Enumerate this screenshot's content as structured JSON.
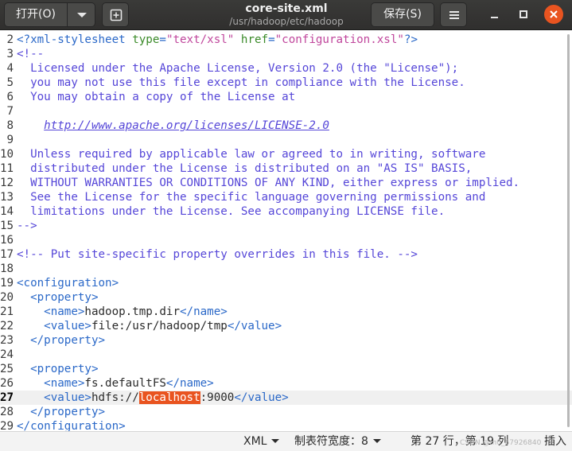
{
  "header": {
    "open_label": "打开(O)",
    "title": "core-site.xml",
    "path": "/usr/hadoop/etc/hadoop",
    "save_label": "保存(S)",
    "icons": {
      "open_menu": "triangle-down-icon",
      "new_tab": "new-document-icon",
      "menu": "hamburger-icon",
      "minimize": "minimize-icon",
      "maximize": "maximize-icon",
      "close": "close-icon"
    },
    "close_color": "#e95420"
  },
  "editor": {
    "current_line": "27",
    "lines": [
      {
        "n": "2",
        "segs": [
          {
            "t": "<?xml-stylesheet ",
            "c": "tag"
          },
          {
            "t": "type",
            "c": "attr"
          },
          {
            "t": "=",
            "c": "tag"
          },
          {
            "t": "\"text/xsl\"",
            "c": "str"
          },
          {
            "t": " ",
            "c": "tag"
          },
          {
            "t": "href",
            "c": "attr"
          },
          {
            "t": "=",
            "c": "tag"
          },
          {
            "t": "\"configuration.xsl\"",
            "c": "str"
          },
          {
            "t": "?>",
            "c": "tag"
          }
        ]
      },
      {
        "n": "3",
        "segs": [
          {
            "t": "<!--",
            "c": "comment"
          }
        ]
      },
      {
        "n": "4",
        "segs": [
          {
            "t": "  Licensed under the Apache License, Version 2.0 (the \"License\");",
            "c": "comment"
          }
        ]
      },
      {
        "n": "5",
        "segs": [
          {
            "t": "  you may not use this file except in compliance with the License.",
            "c": "comment"
          }
        ]
      },
      {
        "n": "6",
        "segs": [
          {
            "t": "  You may obtain a copy of the License at",
            "c": "comment"
          }
        ]
      },
      {
        "n": "7",
        "segs": []
      },
      {
        "n": "8",
        "segs": [
          {
            "t": "    ",
            "c": "comment"
          },
          {
            "t": "http://www.apache.org/licenses/LICENSE-2.0",
            "c": "link"
          }
        ]
      },
      {
        "n": "9",
        "segs": []
      },
      {
        "n": "10",
        "segs": [
          {
            "t": "  Unless required by applicable law or agreed to in writing, software",
            "c": "comment"
          }
        ]
      },
      {
        "n": "11",
        "segs": [
          {
            "t": "  distributed under the License is distributed on an \"AS IS\" BASIS,",
            "c": "comment"
          }
        ]
      },
      {
        "n": "12",
        "segs": [
          {
            "t": "  WITHOUT WARRANTIES OR CONDITIONS OF ANY KIND, either express or implied.",
            "c": "comment"
          }
        ]
      },
      {
        "n": "13",
        "segs": [
          {
            "t": "  See the License for the specific language governing permissions and",
            "c": "comment"
          }
        ]
      },
      {
        "n": "14",
        "segs": [
          {
            "t": "  limitations under the License. See accompanying LICENSE file.",
            "c": "comment"
          }
        ]
      },
      {
        "n": "15",
        "segs": [
          {
            "t": "-->",
            "c": "comment"
          }
        ]
      },
      {
        "n": "16",
        "segs": []
      },
      {
        "n": "17",
        "segs": [
          {
            "t": "<!-- Put site-specific property overrides in this file. -->",
            "c": "comment"
          }
        ]
      },
      {
        "n": "18",
        "segs": []
      },
      {
        "n": "19",
        "segs": [
          {
            "t": "<configuration>",
            "c": "tag"
          }
        ]
      },
      {
        "n": "20",
        "segs": [
          {
            "t": "  <property>",
            "c": "tag"
          }
        ]
      },
      {
        "n": "21",
        "segs": [
          {
            "t": "    <name>",
            "c": "tag"
          },
          {
            "t": "hadoop.tmp.dir",
            "c": "text"
          },
          {
            "t": "</name>",
            "c": "tag"
          }
        ]
      },
      {
        "n": "22",
        "segs": [
          {
            "t": "    <value>",
            "c": "tag"
          },
          {
            "t": "file:/usr/hadoop/tmp",
            "c": "text"
          },
          {
            "t": "</value>",
            "c": "tag"
          }
        ]
      },
      {
        "n": "23",
        "segs": [
          {
            "t": "  </property>",
            "c": "tag"
          }
        ]
      },
      {
        "n": "24",
        "segs": []
      },
      {
        "n": "25",
        "segs": [
          {
            "t": "  <property>",
            "c": "tag"
          }
        ]
      },
      {
        "n": "26",
        "segs": [
          {
            "t": "    <name>",
            "c": "tag"
          },
          {
            "t": "fs.defaultFS",
            "c": "text"
          },
          {
            "t": "</name>",
            "c": "tag"
          }
        ]
      },
      {
        "n": "27",
        "segs": [
          {
            "t": "    <value>",
            "c": "tag"
          },
          {
            "t": "hdfs://",
            "c": "text"
          },
          {
            "t": "localhost",
            "c": "sel"
          },
          {
            "t": ":9000",
            "c": "text"
          },
          {
            "t": "</value>",
            "c": "tag"
          }
        ]
      },
      {
        "n": "28",
        "segs": [
          {
            "t": "  </property>",
            "c": "tag"
          }
        ]
      },
      {
        "n": "29",
        "segs": [
          {
            "t": "</configuration>",
            "c": "tag"
          }
        ]
      }
    ],
    "colors": {
      "comment": "#5546d8",
      "tag": "#2a68c8",
      "attr": "#3a8a28",
      "string": "#c0469c",
      "selection": "#e95420"
    }
  },
  "statusbar": {
    "language": "XML",
    "tab_width": "制表符宽度：8",
    "position": "第 27 行，第 19 列",
    "insert_mode": "插入",
    "watermark": "CSDN @m0_67926840"
  }
}
